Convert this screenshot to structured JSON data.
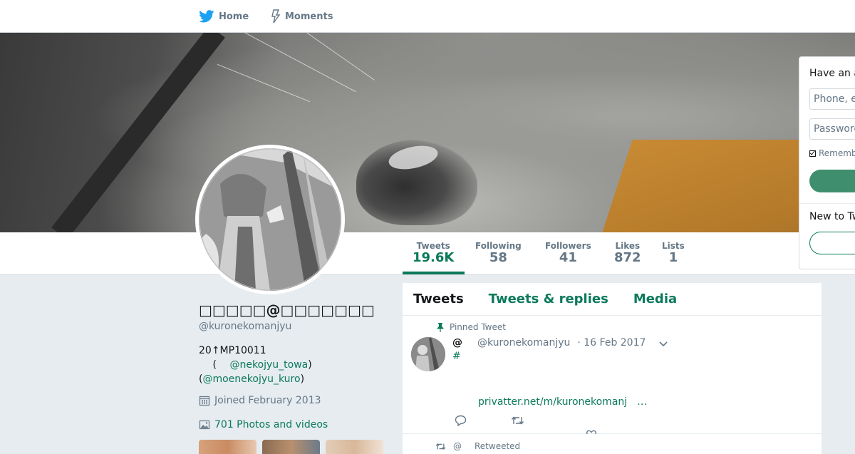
{
  "nav": {
    "home_label": "Home",
    "moments_label": "Moments"
  },
  "profile": {
    "display_name": "□□□□□@□□□□□□□",
    "screen_name": "@kuronekomanjyu",
    "bio_line1": "20↑MP10011",
    "bio_paren_open": "(",
    "bio_mention1": "@nekojyu_towa",
    "bio_paren_close1": ")",
    "bio_paren_open2": "(",
    "bio_mention2": "@moenekojyu_kuro",
    "bio_paren_close2": ")",
    "joined": "Joined February 2013",
    "photos": "701 Photos and videos"
  },
  "stats": [
    {
      "label": "Tweets",
      "value": "19.6K"
    },
    {
      "label": "Following",
      "value": "58"
    },
    {
      "label": "Followers",
      "value": "41"
    },
    {
      "label": "Likes",
      "value": "872"
    },
    {
      "label": "Lists",
      "value": "1"
    }
  ],
  "timeline": {
    "tabs": [
      "Tweets",
      "Tweets & replies",
      "Media"
    ],
    "pinned_label": "Pinned Tweet",
    "tweet": {
      "name": "@",
      "screen_name": "@kuronekomanjyu",
      "date": "· 16 Feb 2017",
      "hashtag": "#",
      "link": "privatter.net/m/kuronekomanj",
      "ellipsis": "…"
    },
    "retweet_at": "@",
    "retweet_label": "Retweeted"
  },
  "login": {
    "title": "Have an account?",
    "phone_placeholder": "Phone, email or username",
    "password_placeholder": "Password",
    "remember": "Remember me",
    "new_to": "New to Twitter?"
  },
  "icons": {
    "home": "twitter-bird-icon",
    "moments": "lightning-icon",
    "calendar": "calendar-icon",
    "photos": "image-icon",
    "pin": "pin-icon",
    "retweet": "retweet-icon",
    "reply": "reply-icon",
    "like": "heart-icon",
    "caret": "chevron-down-icon"
  },
  "colors": {
    "accent": "#0b7a5b",
    "brand_blue": "#1da1f2",
    "muted": "#657786",
    "background": "#e6ecf0"
  }
}
